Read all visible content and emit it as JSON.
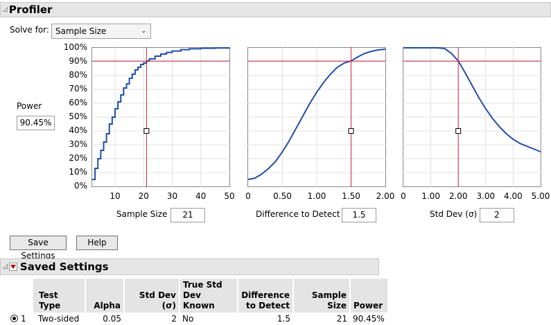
{
  "profiler": {
    "title": "Profiler",
    "solve_for_label": "Solve for:",
    "solve_for_value": "Sample Size",
    "response_label": "Power",
    "response_value": "90.45%",
    "y_ticks": [
      "100%",
      "90%",
      "80%",
      "70%",
      "60%",
      "50%",
      "40%",
      "30%",
      "20%",
      "10%",
      "0%"
    ],
    "factors": [
      {
        "label": "Sample Size",
        "value": "21",
        "ticks": [
          "10",
          "20",
          "30",
          "40",
          "50"
        ]
      },
      {
        "label": "Difference to Detect",
        "value": "1.5",
        "ticks": [
          "0",
          "0.50",
          "1.00",
          "1.50",
          "2.00"
        ]
      },
      {
        "label": "Std Dev (σ)",
        "value": "2",
        "ticks": [
          "0",
          "1.00",
          "2.00",
          "3.00",
          "4.00",
          "5.00"
        ]
      }
    ],
    "save_settings_label": "Save Settings",
    "help_label": "Help"
  },
  "chart_data": [
    {
      "type": "line",
      "xlabel": "Sample Size",
      "ylabel": "Power",
      "xlim": [
        2,
        50
      ],
      "ylim": [
        0,
        1
      ],
      "current": {
        "x": 21,
        "y": 0.9045
      },
      "x": [
        2,
        3,
        4,
        5,
        6,
        7,
        8,
        9,
        10,
        11,
        12,
        13,
        14,
        15,
        16,
        17,
        18,
        19,
        20,
        21,
        22,
        24,
        26,
        28,
        30,
        33,
        36,
        40,
        45,
        50
      ],
      "y": [
        0.05,
        0.13,
        0.2,
        0.26,
        0.32,
        0.38,
        0.45,
        0.5,
        0.56,
        0.61,
        0.66,
        0.71,
        0.74,
        0.78,
        0.81,
        0.84,
        0.86,
        0.88,
        0.89,
        0.905,
        0.92,
        0.94,
        0.955,
        0.967,
        0.977,
        0.987,
        0.993,
        0.997,
        0.999,
        1.0
      ]
    },
    {
      "type": "line",
      "xlabel": "Difference to Detect",
      "ylabel": "Power",
      "xlim": [
        0,
        2
      ],
      "ylim": [
        0,
        1
      ],
      "current": {
        "x": 1.5,
        "y": 0.9045
      },
      "x": [
        0,
        0.1,
        0.2,
        0.3,
        0.4,
        0.5,
        0.6,
        0.7,
        0.8,
        0.9,
        1.0,
        1.1,
        1.2,
        1.3,
        1.4,
        1.5,
        1.6,
        1.7,
        1.8,
        1.9,
        2.0
      ],
      "y": [
        0.05,
        0.06,
        0.09,
        0.13,
        0.18,
        0.25,
        0.33,
        0.42,
        0.51,
        0.6,
        0.68,
        0.75,
        0.81,
        0.86,
        0.89,
        0.905,
        0.935,
        0.96,
        0.975,
        0.985,
        0.99
      ]
    },
    {
      "type": "line",
      "xlabel": "Std Dev (σ)",
      "ylabel": "Power",
      "xlim": [
        0,
        5
      ],
      "ylim": [
        0,
        1
      ],
      "current": {
        "x": 2,
        "y": 0.9045
      },
      "x": [
        0,
        0.5,
        1.0,
        1.25,
        1.5,
        1.75,
        2.0,
        2.25,
        2.5,
        2.75,
        3.0,
        3.25,
        3.5,
        3.75,
        4.0,
        4.25,
        4.5,
        4.75,
        5.0
      ],
      "y": [
        1.0,
        1.0,
        1.0,
        1.0,
        0.995,
        0.96,
        0.905,
        0.82,
        0.73,
        0.64,
        0.56,
        0.49,
        0.43,
        0.38,
        0.34,
        0.31,
        0.29,
        0.27,
        0.25
      ]
    }
  ],
  "saved_settings": {
    "title": "Saved Settings",
    "columns": [
      "",
      "Test Type",
      "Alpha",
      "Std Dev (σ)",
      "True Std Dev Known",
      "Difference to Detect",
      "Sample Size",
      "Power"
    ],
    "rows": [
      [
        "1",
        "Two-sided",
        "0.05",
        "2",
        "No",
        "1.5",
        "21",
        "90.45%"
      ]
    ]
  }
}
